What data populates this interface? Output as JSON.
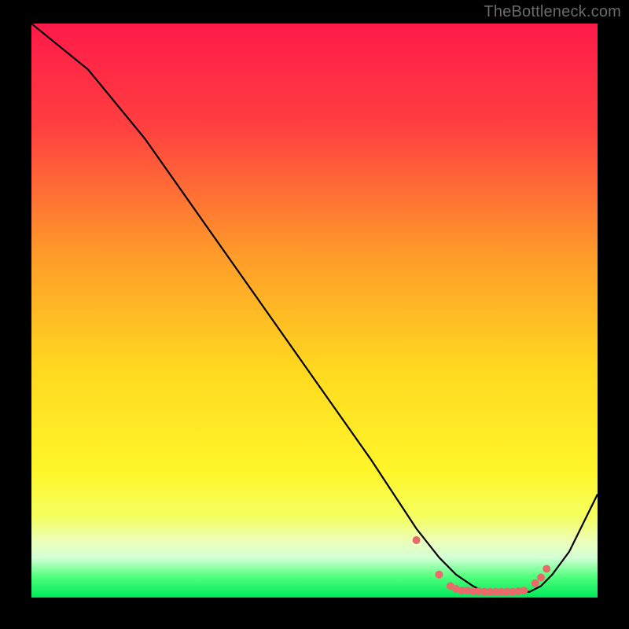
{
  "watermark": "TheBottleneck.com",
  "chart_data": {
    "type": "line",
    "title": "",
    "xlabel": "",
    "ylabel": "",
    "xlim": [
      0,
      100
    ],
    "ylim": [
      0,
      100
    ],
    "grid": false,
    "legend": false,
    "gradient_stops": [
      {
        "offset": 0.0,
        "color": "#ff1a49"
      },
      {
        "offset": 0.18,
        "color": "#ff4040"
      },
      {
        "offset": 0.4,
        "color": "#ff9a2a"
      },
      {
        "offset": 0.6,
        "color": "#ffd81f"
      },
      {
        "offset": 0.78,
        "color": "#fff62a"
      },
      {
        "offset": 0.86,
        "color": "#f4ff60"
      },
      {
        "offset": 0.9,
        "color": "#ecffb7"
      },
      {
        "offset": 0.93,
        "color": "#d6ffd6"
      },
      {
        "offset": 0.965,
        "color": "#4dff7a"
      },
      {
        "offset": 1.0,
        "color": "#00e85a"
      }
    ],
    "series": [
      {
        "name": "bottleneck-curve",
        "color": "#000000",
        "x": [
          0,
          5,
          10,
          20,
          30,
          40,
          50,
          60,
          68,
          72,
          75,
          78,
          80,
          82,
          84,
          86,
          88,
          90,
          92,
          95,
          100
        ],
        "y": [
          100,
          96,
          92,
          80,
          66,
          52,
          38,
          24,
          12,
          7,
          4,
          2,
          1,
          1,
          1,
          1,
          1,
          2,
          4,
          8,
          18
        ]
      }
    ],
    "marker_series": {
      "name": "measured-points",
      "color": "#e86a6a",
      "radius": 5,
      "x": [
        68,
        72,
        74,
        75,
        76,
        77,
        78,
        79,
        80,
        81,
        82,
        83,
        84,
        85,
        86,
        87,
        89,
        90,
        91
      ],
      "y": [
        10,
        4,
        2,
        1.5,
        1.2,
        1.2,
        1.1,
        1.1,
        1.0,
        1.0,
        1.0,
        1.0,
        1.0,
        1.0,
        1.1,
        1.2,
        2.5,
        3.5,
        5
      ]
    }
  }
}
